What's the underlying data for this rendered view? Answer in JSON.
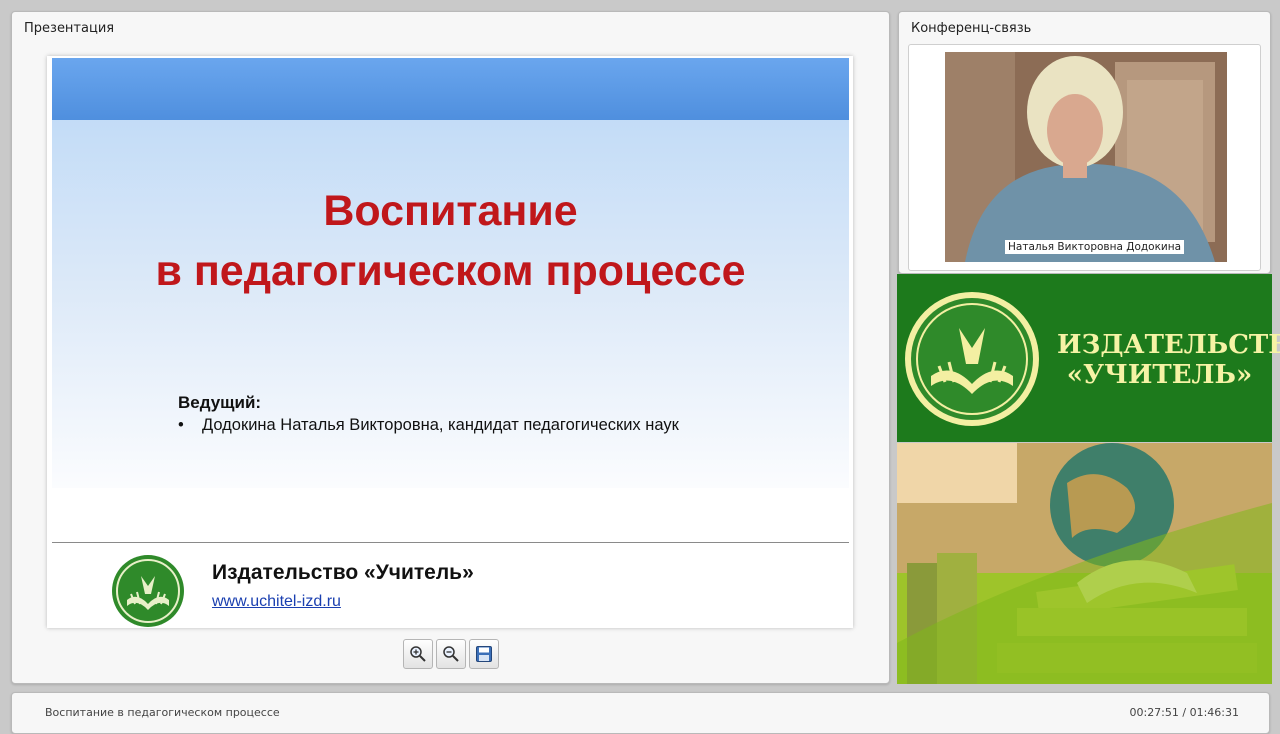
{
  "presentation": {
    "panel_title": "Презентация",
    "slide": {
      "title_line1": "Воспитание",
      "title_line2": "в педагогическом процессе",
      "host_label": "Ведущий:",
      "host_bullet": "•",
      "host_text": "Додокина Наталья Викторовна, кандидат педагогических наук",
      "publisher_name": "Издательство «Учитель»",
      "publisher_url": "www.uchitel-izd.ru"
    },
    "toolbar": [
      {
        "icon": "zoom-in-icon"
      },
      {
        "icon": "zoom-out-icon"
      },
      {
        "icon": "save-icon"
      }
    ]
  },
  "conference": {
    "panel_title": "Конференц-связь",
    "speaker_name": "Наталья Викторовна Додокина"
  },
  "banner": {
    "line1": "ИЗДАТЕЛЬСТВО",
    "line2": "«УЧИТЕЛЬ»"
  },
  "status": {
    "title": "Воспитание в педагогическом процессе",
    "time": "00:27:51 / 01:46:31"
  },
  "colors": {
    "slide_title": "#c0171b",
    "banner_green": "#1d7a1c",
    "banner_text": "#f6f3a5",
    "slide_header_blue": "#5a9ae6"
  }
}
